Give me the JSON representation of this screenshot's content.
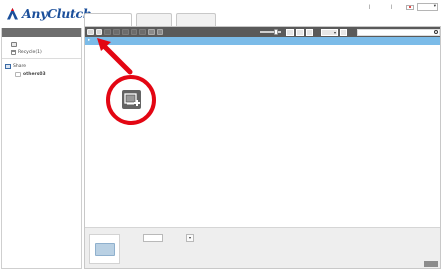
{
  "app": {
    "logo_text": "AnyClutch",
    "brand_color": "#1b4f9b",
    "accent_red": "#e30613"
  },
  "topbar": {
    "user_links": "            |          |     ",
    "language": "    "
  },
  "tabs": [
    {
      "label": "      ",
      "active": true
    },
    {
      "label": "    ",
      "active": false
    },
    {
      "label": "    ",
      "active": false
    }
  ],
  "sidebar": {
    "header": "      ",
    "favorites_label": "     ",
    "recycle_label": "Recycle(1)",
    "server_label": "Share",
    "folder_label": "others03"
  },
  "toolbar": {
    "sort_label": "   ",
    "search_placeholder": "       ",
    "icons": [
      "refresh-icon",
      "upload-icon",
      "download-icon",
      "cut-icon",
      "copy-icon",
      "paste-icon",
      "delete-icon",
      "new-folder-icon"
    ]
  },
  "pathbar": {
    "path": "▸     ",
    "right_label": "        "
  },
  "details": {
    "name": "    ",
    "type_label": "      ",
    "meta_left": "       ",
    "meta_right": "           ",
    "badge": "      "
  },
  "callout": {
    "icon": "new-folder-icon"
  }
}
